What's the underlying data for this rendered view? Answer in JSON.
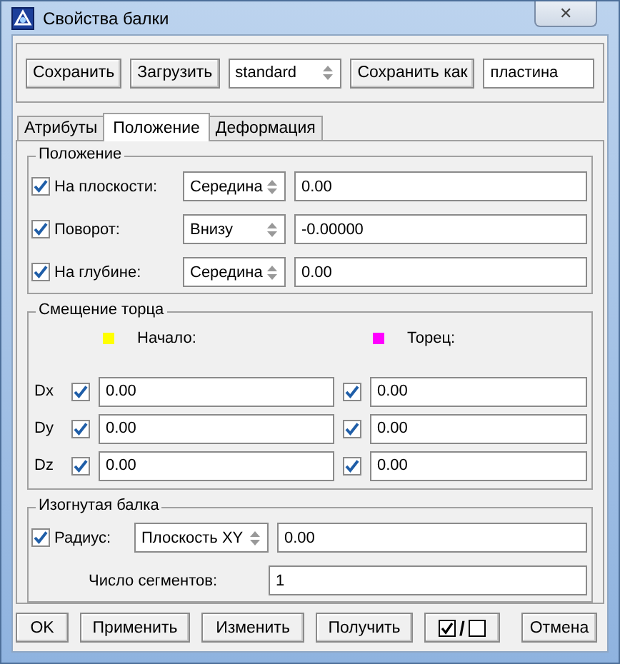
{
  "window": {
    "title": "Свойства балки",
    "close": "✕"
  },
  "toolbar": {
    "save": "Сохранить",
    "load": "Загрузить",
    "preset": "standard",
    "save_as": "Сохранить как",
    "save_as_name": "пластина"
  },
  "tabs": [
    {
      "label": "Атрибуты",
      "selected": false
    },
    {
      "label": "Положение",
      "selected": true
    },
    {
      "label": "Деформация",
      "selected": false
    }
  ],
  "position": {
    "title": "Положение",
    "rows": [
      {
        "label": "На плоскости:",
        "checked": true,
        "option": "Середина",
        "value": "0.00"
      },
      {
        "label": "Поворот:",
        "checked": true,
        "option": "Внизу",
        "value": "-0.00000"
      },
      {
        "label": "На глубине:",
        "checked": true,
        "option": "Середина",
        "value": "0.00"
      }
    ]
  },
  "end_offset": {
    "title": "Смещение торца",
    "ends": [
      {
        "label": "Начало:",
        "color": "#ffff00"
      },
      {
        "label": "Торец:",
        "color": "#ff00ff"
      }
    ],
    "rows": [
      {
        "label": "Dx",
        "start": {
          "checked": true,
          "value": "0.00"
        },
        "end": {
          "checked": true,
          "value": "0.00"
        }
      },
      {
        "label": "Dy",
        "start": {
          "checked": true,
          "value": "0.00"
        },
        "end": {
          "checked": true,
          "value": "0.00"
        }
      },
      {
        "label": "Dz",
        "start": {
          "checked": true,
          "value": "0.00"
        },
        "end": {
          "checked": true,
          "value": "0.00"
        }
      }
    ]
  },
  "curved_beam": {
    "title": "Изогнутая балка",
    "radius": {
      "label": "Радиус:",
      "checked": true,
      "option": "Плоскость XY",
      "value": "0.00"
    },
    "segments": {
      "label": "Число сегментов:",
      "value": "1"
    }
  },
  "buttons": {
    "ok": "OK",
    "apply": "Применить",
    "modify": "Изменить",
    "get": "Получить",
    "toggle": "/",
    "cancel": "Отмена"
  }
}
